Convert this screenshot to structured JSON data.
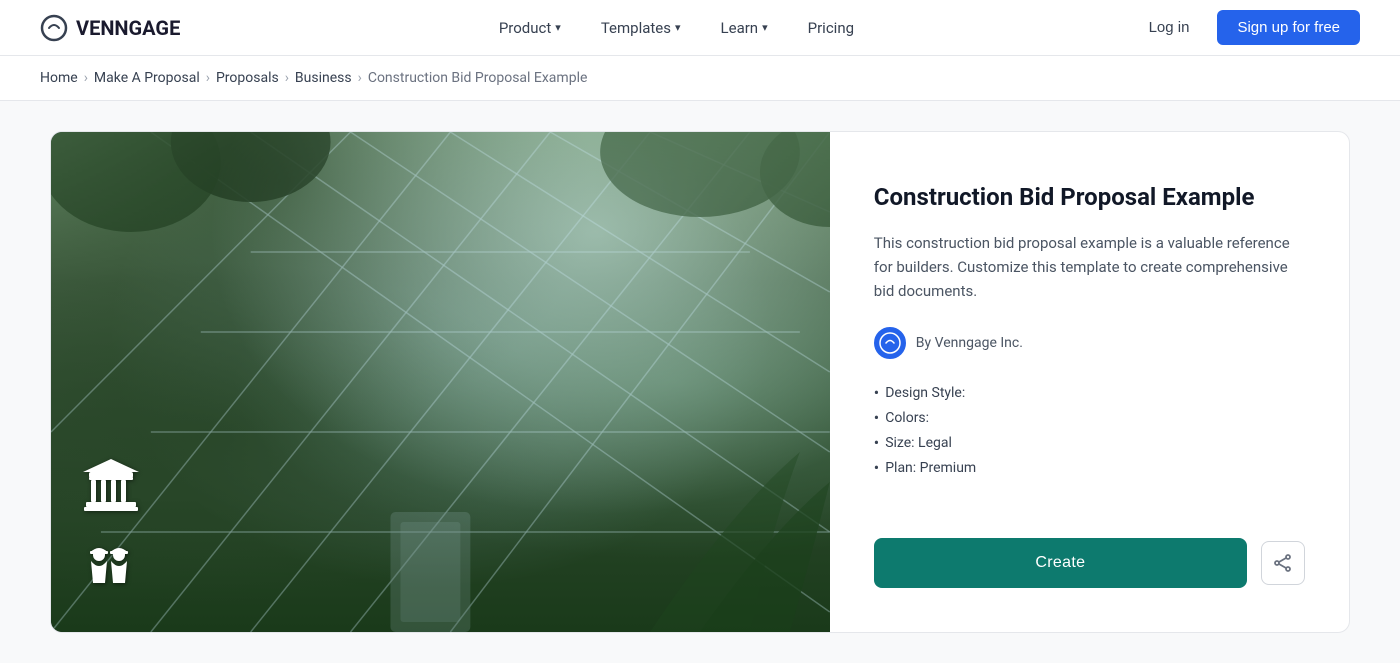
{
  "navbar": {
    "logo_text": "VENNGAGE",
    "nav_items": [
      {
        "id": "product",
        "label": "Product"
      },
      {
        "id": "templates",
        "label": "Templates"
      },
      {
        "id": "learn",
        "label": "Learn"
      },
      {
        "id": "pricing",
        "label": "Pricing"
      }
    ],
    "login_label": "Log in",
    "signup_label": "Sign up for free"
  },
  "breadcrumb": {
    "items": [
      {
        "id": "home",
        "label": "Home",
        "active": false
      },
      {
        "id": "make-proposal",
        "label": "Make A Proposal",
        "active": false
      },
      {
        "id": "proposals",
        "label": "Proposals",
        "active": false
      },
      {
        "id": "business",
        "label": "Business",
        "active": false
      },
      {
        "id": "current",
        "label": "Construction Bid Proposal Example",
        "active": true
      }
    ]
  },
  "template": {
    "title": "Construction Bid Proposal Example",
    "description": "This construction bid proposal example is a valuable reference for builders. Customize this template to create comprehensive bid documents.",
    "author": "By Venngage Inc.",
    "meta": [
      {
        "label": "Design Style:",
        "value": ""
      },
      {
        "label": "Colors:",
        "value": ""
      },
      {
        "label": "Size: Legal",
        "value": ""
      },
      {
        "label": "Plan: Premium",
        "value": ""
      }
    ],
    "create_label": "Create",
    "share_icon": "share-icon"
  }
}
